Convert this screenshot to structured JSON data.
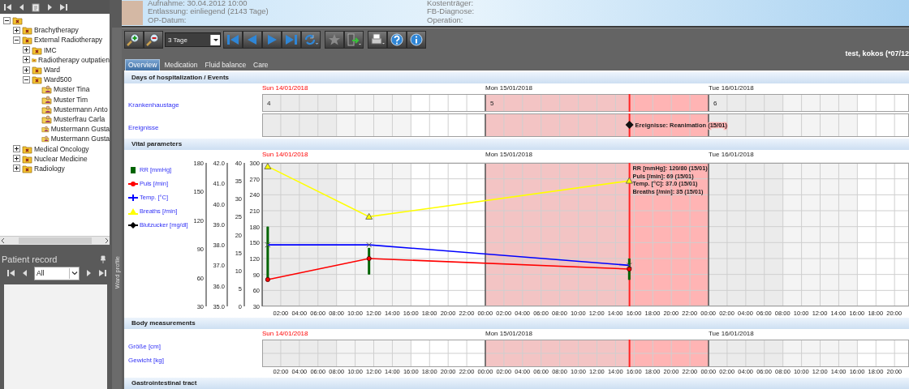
{
  "tree": {
    "expanded": true,
    "kind": "folder",
    "children": [
      {
        "label": "Brachytherapy",
        "kind": "folder",
        "expanded": false
      },
      {
        "label": "External Radiotherapy",
        "kind": "folder",
        "expanded": true,
        "children": [
          {
            "label": "IMC",
            "kind": "folder",
            "expanded": false
          },
          {
            "label": "Radiotherapy outpatien",
            "kind": "folder",
            "expanded": false
          },
          {
            "label": "Ward",
            "kind": "folder",
            "expanded": false
          },
          {
            "label": "Ward500",
            "kind": "folder",
            "expanded": true,
            "children": [
              {
                "label": "Muster Tina",
                "kind": "patient"
              },
              {
                "label": "Muster Tim",
                "kind": "patient"
              },
              {
                "label": "Mustermann Anto",
                "kind": "patient"
              },
              {
                "label": "Musterfrau Carla",
                "kind": "patient"
              },
              {
                "label": "Mustermann Gusta",
                "kind": "patient"
              },
              {
                "label": "Mustermann Gusta",
                "kind": "patient"
              }
            ]
          }
        ]
      },
      {
        "label": "Medical Oncology",
        "kind": "folder",
        "expanded": false
      },
      {
        "label": "Nuclear Medicine",
        "kind": "folder",
        "expanded": false
      },
      {
        "label": "Radiology",
        "kind": "folder",
        "expanded": false
      }
    ]
  },
  "patient_record": {
    "title": "Patient record",
    "filter": "All"
  },
  "side_tab": {
    "label": "Ward profile"
  },
  "header": {
    "left": [
      "Aufnahme: 30.04.2012 10:00",
      "Entlassung: einliegend (2143 Tage)",
      "OP-Datum:"
    ],
    "right": [
      "Kostenträger:",
      "FB-Diagnose:",
      "Operation:"
    ]
  },
  "toolbar": {
    "range": "3 Tage"
  },
  "patient_name": "test, kokos (*07/12",
  "tabs": [
    {
      "label": "Overview",
      "selected": true
    },
    {
      "label": "Medication",
      "selected": false
    },
    {
      "label": "Fluid balance",
      "selected": false
    },
    {
      "label": "Care",
      "selected": false
    }
  ],
  "sections": [
    {
      "title": "Days of hospitalization / Events",
      "kind": "days",
      "days": [
        {
          "label": "Sun 14/01/2018",
          "weekend": true,
          "today": false
        },
        {
          "label": "Mon 15/01/2018",
          "weekend": false,
          "today": true
        },
        {
          "label": "Tue 16/01/2018",
          "weekend": false,
          "today": false
        }
      ],
      "rows": [
        {
          "label": "Krankenhaustage",
          "kind": "day_count",
          "values": [
            "4",
            "5",
            "6"
          ]
        },
        {
          "label": "Ereignisse",
          "kind": "events",
          "events": [
            {
              "text": "Ereignisse: Reanimation (15/01)",
              "kind": "now"
            }
          ]
        }
      ]
    },
    {
      "title": "Vital parameters",
      "kind": "vitals",
      "days": [
        {
          "label": "Sun 14/01/2018",
          "weekend": true
        },
        {
          "label": "Mon 15/01/2018",
          "weekend": false
        },
        {
          "label": "Tue 16/01/2018",
          "weekend": false
        }
      ],
      "charts": [
        {
          "chart_data": {
            "type": "candlestick",
            "x": [
              "2018-01-14 00:36",
              "2018-01-14 11:30",
              "2018-01-15 15:30"
            ],
            "xlim": [
              "2018-01-14 00:00",
              "2018-01-16 21:36"
            ],
            "xticks": [
              {
                "value": "2018-01-14 02:00",
                "label": "02:00"
              },
              {
                "value": "2018-01-14 04:00",
                "label": "04:00"
              },
              {
                "value": "2018-01-14 06:00",
                "label": "06:00"
              },
              {
                "value": "2018-01-14 08:00",
                "label": "08:00"
              },
              {
                "value": "2018-01-14 10:00",
                "label": "10:00"
              },
              {
                "value": "2018-01-14 12:00",
                "label": "12:00"
              },
              {
                "value": "2018-01-14 14:00",
                "label": "14:00"
              },
              {
                "value": "2018-01-14 16:00",
                "label": "16:00"
              },
              {
                "value": "2018-01-14 18:00",
                "label": "18:00"
              },
              {
                "value": "2018-01-14 20:00",
                "label": "20:00"
              },
              {
                "value": "2018-01-14 22:00",
                "label": "22:00"
              },
              {
                "value": "2018-01-15 00:00",
                "label": "00:00"
              },
              {
                "value": "2018-01-15 02:00",
                "label": "02:00"
              },
              {
                "value": "2018-01-15 04:00",
                "label": "04:00"
              },
              {
                "value": "2018-01-15 06:00",
                "label": "06:00"
              },
              {
                "value": "2018-01-15 08:00",
                "label": "08:00"
              },
              {
                "value": "2018-01-15 10:00",
                "label": "10:00"
              },
              {
                "value": "2018-01-15 12:00",
                "label": "12:00"
              },
              {
                "value": "2018-01-15 14:00",
                "label": "14:00"
              },
              {
                "value": "2018-01-15 16:00",
                "label": "16:00"
              },
              {
                "value": "2018-01-15 18:00",
                "label": "18:00"
              },
              {
                "value": "2018-01-15 20:00",
                "label": "20:00"
              },
              {
                "value": "2018-01-15 22:00",
                "label": "22:00"
              },
              {
                "value": "2018-01-16 00:00",
                "label": "00:00"
              },
              {
                "value": "2018-01-16 02:00",
                "label": "02:00"
              },
              {
                "value": "2018-01-16 04:00",
                "label": "04:00"
              },
              {
                "value": "2018-01-16 06:00",
                "label": "06:00"
              },
              {
                "value": "2018-01-16 08:00",
                "label": "08:00"
              },
              {
                "value": "2018-01-16 10:00",
                "label": "10:00"
              },
              {
                "value": "2018-01-16 12:00",
                "label": "12:00"
              },
              {
                "value": "2018-01-16 14:00",
                "label": "14:00"
              },
              {
                "value": "2018-01-16 16:00",
                "label": "16:00"
              },
              {
                "value": "2018-01-16 18:00",
                "label": "18:00"
              },
              {
                "value": "2018-01-16 20:00",
                "label": "20:00"
              }
            ],
            "ylim": [
              30,
              300
            ],
            "yticks": [
              30,
              60,
              90,
              120,
              150,
              180,
              210,
              240,
              270,
              300
            ],
            "grid": true,
            "series": [
              {
                "name": "RR [mmHg]",
                "color": "#006400",
                "marker": "bar",
                "ohlc": [
                  [
                    180,
                    180,
                    80,
                    80
                  ],
                  [
                    140,
                    140,
                    90,
                    90
                  ],
                  [
                    120,
                    120,
                    80,
                    80
                  ]
                ]
              }
            ],
            "bands": [
              {
                "axis": "x",
                "from": "2018-01-15 00:00",
                "to": "2018-01-15 15:30",
                "color": "#f3c4c4"
              },
              {
                "axis": "x",
                "from": "2018-01-15 15:30",
                "to": "2018-01-16 00:00",
                "color": "#ffb4b4"
              }
            ],
            "ref_lines": [
              {
                "axis": "x",
                "value": "2018-01-15 15:30",
                "color": "#ff2424"
              }
            ]
          }
        },
        {
          "chart_data": {
            "type": "line",
            "x": [
              "2018-01-14 00:36",
              "2018-01-14 11:30",
              "2018-01-15 15:30"
            ],
            "xlim": [
              "2018-01-14 00:00",
              "2018-01-16 21:36"
            ],
            "ylim": [
              30,
              180
            ],
            "yticks": [
              30,
              60,
              90,
              120,
              150,
              180
            ],
            "series": [
              {
                "name": "Puls [/min]",
                "color": "#ff0000",
                "marker": "circle",
                "values": [
                  58,
                  80,
                  69
                ]
              }
            ]
          }
        },
        {
          "chart_data": {
            "type": "line",
            "x": [
              "2018-01-14 00:36",
              "2018-01-14 11:30",
              "2018-01-15 15:30"
            ],
            "xlim": [
              "2018-01-14 00:00",
              "2018-01-16 21:36"
            ],
            "ylim": [
              35,
              42
            ],
            "yticks": [
              {
                "value": 35,
                "label": "35.0"
              },
              {
                "value": 36,
                "label": "36.0"
              },
              {
                "value": 37,
                "label": "37.0"
              },
              {
                "value": 38,
                "label": "38.0"
              },
              {
                "value": 39,
                "label": "39.0"
              },
              {
                "value": 40,
                "label": "40.0"
              },
              {
                "value": 41,
                "label": "41.0"
              },
              {
                "value": 42,
                "label": "42.0"
              }
            ],
            "series": [
              {
                "name": "Temp. [°C]",
                "color": "#0000ff",
                "marker": "cross",
                "values": [
                  38.0,
                  38.0,
                  37.0
                ]
              }
            ]
          }
        },
        {
          "chart_data": {
            "type": "line",
            "x": [
              "2018-01-14 00:36",
              "2018-01-14 11:30",
              "2018-01-15 15:30"
            ],
            "xlim": [
              "2018-01-14 00:00",
              "2018-01-16 21:36"
            ],
            "ylim": [
              0,
              40
            ],
            "yticks": [
              0,
              5,
              10,
              15,
              20,
              25,
              30,
              35,
              40
            ],
            "series": [
              {
                "name": "Breaths [/min]",
                "color": "#ffff00",
                "marker": "triangle",
                "values": [
                  39,
                  25,
                  35
                ]
              },
              {
                "name": "Blutzucker [mg/dl]",
                "color": "#000000",
                "marker": "diamond",
                "values": [
                  null,
                  null,
                  null
                ]
              }
            ]
          }
        }
      ],
      "tooltip": [
        "RR [mmHg]: 120/80 (15/01)",
        "Puls [/min]: 69 (15/01)",
        "Temp. [°C]: 37.0 (15/01)",
        "Breaths [/min]: 35 (15/01)"
      ]
    },
    {
      "title": "Body measurements",
      "kind": "rows",
      "days": [
        {
          "label": "Sun 14/01/2018",
          "weekend": true,
          "today": false
        },
        {
          "label": "Mon 15/01/2018",
          "weekend": false,
          "today": true
        },
        {
          "label": "Tue 16/01/2018",
          "weekend": false,
          "today": false
        }
      ],
      "rows": [
        {
          "label": "Größe [cm]"
        },
        {
          "label": "Gewicht [kg]"
        }
      ],
      "time_labels": [
        "02:00",
        "04:00",
        "06:00",
        "08:00",
        "10:00",
        "12:00",
        "14:00",
        "16:00",
        "18:00",
        "20:00",
        "22:00",
        "00:00",
        "02:00",
        "04:00",
        "06:00",
        "08:00",
        "10:00",
        "12:00",
        "14:00",
        "16:00",
        "18:00",
        "20:00",
        "22:00",
        "00:00",
        "02:00",
        "04:00",
        "06:00",
        "08:00",
        "10:00",
        "12:00",
        "14:00",
        "16:00",
        "18:00",
        "20:00"
      ]
    },
    {
      "title": "Gastrointestinal tract",
      "kind": "header"
    }
  ]
}
